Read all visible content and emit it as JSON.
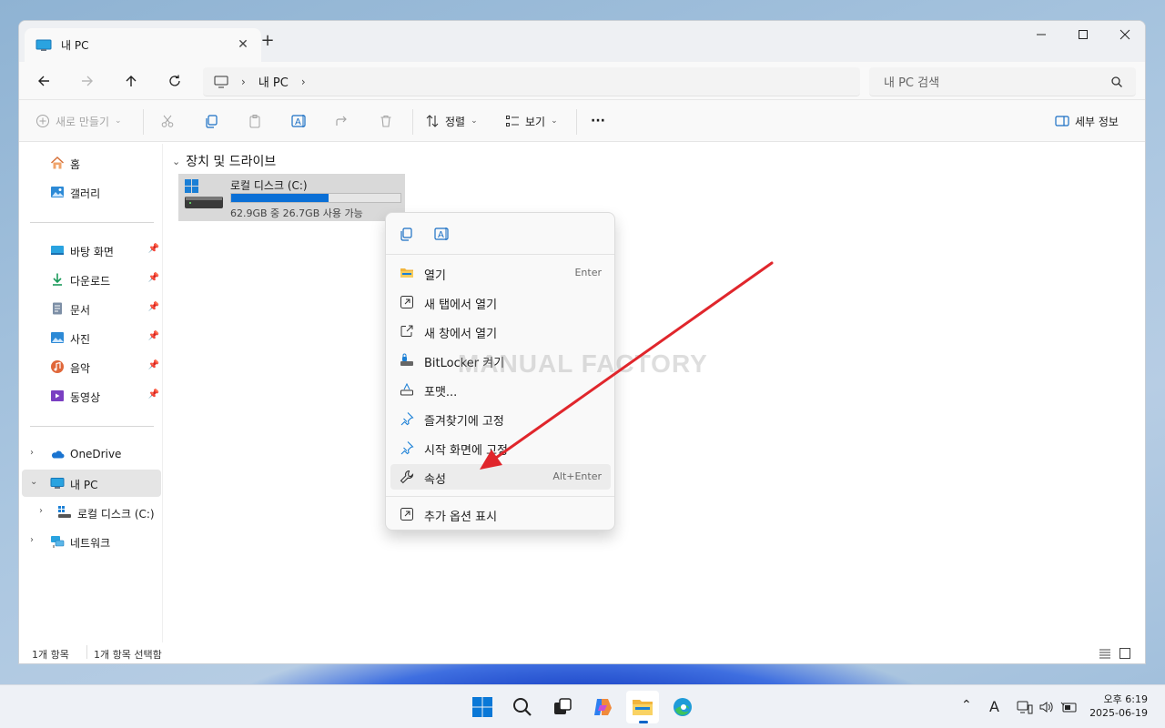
{
  "window": {
    "tab_title": "내 PC",
    "tab_add": "+"
  },
  "navbar": {
    "breadcrumb_item": "내 PC",
    "search_placeholder": "내 PC 검색"
  },
  "toolbar": {
    "new_label": "새로 만들기",
    "sort_label": "정렬",
    "view_label": "보기",
    "more_label": "···",
    "details_label": "세부 정보"
  },
  "sidebar": {
    "home": "홈",
    "gallery": "갤러리",
    "quick": [
      {
        "label": "바탕 화면"
      },
      {
        "label": "다운로드"
      },
      {
        "label": "문서"
      },
      {
        "label": "사진"
      },
      {
        "label": "음악"
      },
      {
        "label": "동영상"
      }
    ],
    "onedrive": "OneDrive",
    "this_pc": "내 PC",
    "local_disk": "로컬 디스크 (C:)",
    "network": "네트워크"
  },
  "main": {
    "group_header": "장치 및 드라이브",
    "drive": {
      "name": "로컬 디스크 (C:)",
      "free_text": "62.9GB 중 26.7GB 사용 가능",
      "used_fraction": 0.576
    }
  },
  "context_menu": {
    "items": [
      {
        "label": "열기",
        "shortcut": "Enter"
      },
      {
        "label": "새 탭에서 열기",
        "shortcut": ""
      },
      {
        "label": "새 창에서 열기",
        "shortcut": ""
      },
      {
        "label": "BitLocker 켜기",
        "shortcut": ""
      },
      {
        "label": "포맷...",
        "shortcut": ""
      },
      {
        "label": "즐겨찾기에 고정",
        "shortcut": ""
      },
      {
        "label": "시작 화면에 고정",
        "shortcut": ""
      },
      {
        "label": "속성",
        "shortcut": "Alt+Enter"
      },
      {
        "label": "추가 옵션 표시",
        "shortcut": ""
      }
    ]
  },
  "watermark": "MANUAL FACTORY",
  "statusbar": {
    "count": "1개 항목",
    "selected": "1개 항목 선택함"
  },
  "taskbar": {
    "time": "오후 6:19",
    "date": "2025-06-19",
    "ime": "A"
  },
  "colors": {
    "accent": "#0a6fd6",
    "annotation_arrow": "#e0262c"
  }
}
